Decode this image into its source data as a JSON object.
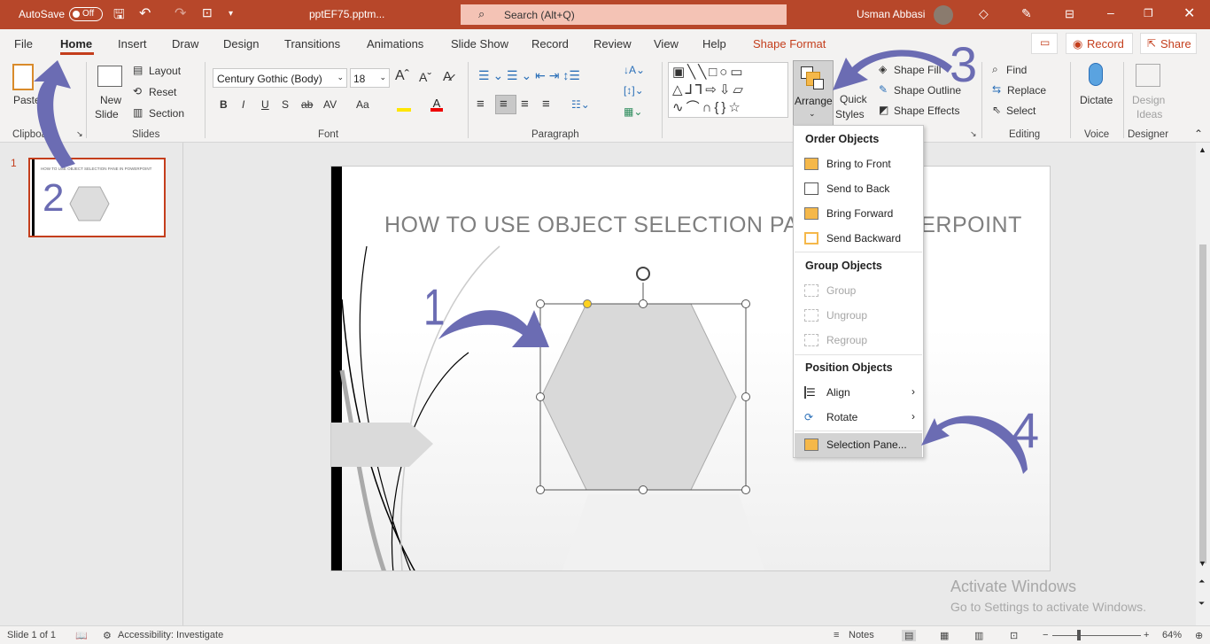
{
  "titlebar": {
    "autosave_label": "AutoSave",
    "autosave_state": "Off",
    "filename": "pptEF75.pptm...",
    "search_placeholder": "Search (Alt+Q)",
    "user_name": "Usman Abbasi"
  },
  "tabs": [
    "File",
    "Home",
    "Insert",
    "Draw",
    "Design",
    "Transitions",
    "Animations",
    "Slide Show",
    "Record",
    "Review",
    "View",
    "Help",
    "Shape Format"
  ],
  "active_tab": "Home",
  "header_buttons": {
    "record": "Record",
    "share": "Share"
  },
  "ribbon": {
    "clipboard": {
      "paste": "Paste",
      "label": "Clipboard"
    },
    "slides": {
      "new_slide_1": "New",
      "new_slide_2": "Slide",
      "layout": "Layout",
      "reset": "Reset",
      "section": "Section",
      "label": "Slides"
    },
    "font": {
      "font_name": "Century Gothic (Body)",
      "font_size": "18",
      "bold": "B",
      "italic": "I",
      "underline": "U",
      "shadow": "S",
      "strike": "ab",
      "spacing": "AV",
      "case": "Aa",
      "label": "Font"
    },
    "paragraph": {
      "label": "Paragraph"
    },
    "drawing": {
      "arrange": "Arrange",
      "quick_styles_1": "Quick",
      "quick_styles_2": "Styles",
      "shape_fill": "Shape Fill",
      "shape_outline": "Shape Outline",
      "shape_effects": "Shape Effects"
    },
    "editing": {
      "find": "Find",
      "replace": "Replace",
      "select": "Select",
      "label": "Editing"
    },
    "voice": {
      "dictate": "Dictate",
      "label": "Voice"
    },
    "designer": {
      "design_ideas_1": "Design",
      "design_ideas_2": "Ideas",
      "label": "Designer"
    }
  },
  "thumbnail": {
    "number": "1",
    "title": "HOW TO USE OBJECT SELECTION PANE IN POWERPOINT"
  },
  "slide": {
    "title": "HOW TO USE OBJECT  SELECTION PANE IN POWERPOINT"
  },
  "arrange_menu": {
    "order_header": "Order Objects",
    "order_items": [
      "Bring to Front",
      "Send to Back",
      "Bring Forward",
      "Send Backward"
    ],
    "group_header": "Group Objects",
    "group_items": [
      "Group",
      "Ungroup",
      "Regroup"
    ],
    "position_header": "Position Objects",
    "position_items": [
      "Align",
      "Rotate"
    ],
    "selection_pane": "Selection Pane..."
  },
  "annotations": {
    "step1": "1",
    "step2": "2",
    "step3": "3",
    "step4": "4",
    "arrow_color": "#6b6cb3"
  },
  "watermark": {
    "line1": "Activate Windows",
    "line2": "Go to Settings to activate Windows."
  },
  "status": {
    "slide_counter": "Slide 1 of 1",
    "accessibility": "Accessibility: Investigate",
    "notes": "Notes",
    "zoom": "64%"
  },
  "colors": {
    "brand": "#b7472a",
    "accent_tab": "#c43e1c",
    "thumb_border": "#c43e1c"
  }
}
